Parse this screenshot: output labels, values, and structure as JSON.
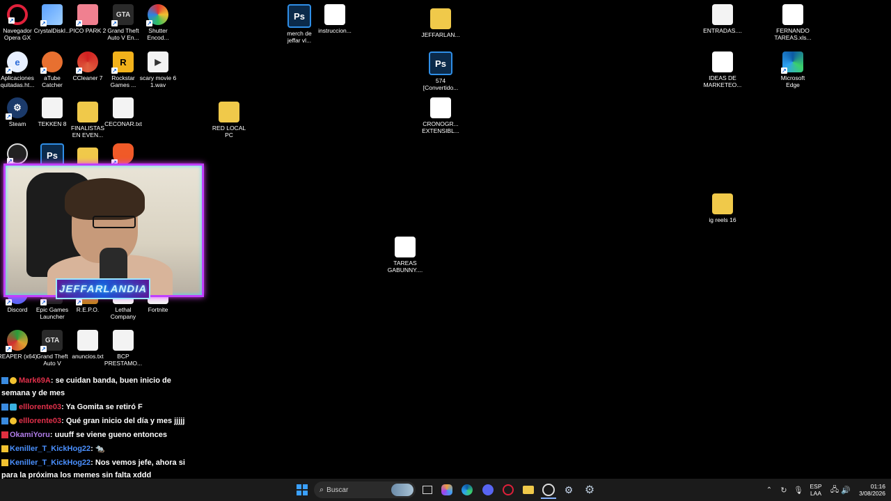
{
  "desktop_icons": {
    "opera": "Navegador\nOpera GX",
    "crystaldisk": "CrystalDiskI...",
    "picopark": "PICO PARK 2",
    "gta_en": "Grand Theft\nAuto V En...",
    "shutter_encod": "Shutter\nEncod...",
    "merch": "merch de\njeffar vl...",
    "instruccion": "instruccion...",
    "jeffarlan_folder": "JEFFARLAN...",
    "entradas": "ENTRADAS....",
    "fernando": "FERNANDO\nTAREAS.xls...",
    "aplicaciones": "Aplicaciones\nquitadas.ht...",
    "atube": "aTube\nCatcher",
    "ccleaner": "CCleaner 7",
    "rockstar": "Rockstar\nGames ...",
    "scary": "scary movie 6\n1.wav",
    "ps574": "574\n[Convertido...",
    "ideas": "IDEAS DE\nMARKETEO...",
    "edge": "Microsoft\nEdge",
    "steam": "Steam",
    "tekken": "TEKKEN 8",
    "finalistas": "FINALISTAS\nEN EVEN...",
    "ceconar": "CECONAR.txt",
    "redlocal": "RED LOCAL\nPC",
    "cronogr": "CRONOGR...\nEXTENSIBL...",
    "igreels": "ig reels 16",
    "tareas_gab": "TAREAS\nGABUNNY....",
    "discord": "Discord",
    "epic": "Epic Games\nLauncher",
    "repo": "R.E.P.O.",
    "lethal": "Lethal\nCompany",
    "fortnite": "Fortnite",
    "reaper": "REAPER (x64)",
    "gta_v": "Grand Theft\nAuto V",
    "anuncios": "anuncios.txt",
    "bcp": "BCP\nPRESTAMO..."
  },
  "webcam": {
    "banner_text": "JEFFARLANDIA"
  },
  "chat": [
    {
      "user": "Mark69A",
      "user_color": "#e0304a",
      "text": ": se cuidan banda, buen inicio de semana y de mes"
    },
    {
      "user": "elllorente03",
      "user_color": "#e0304a",
      "text": ": Ya Gomita se retiró F"
    },
    {
      "user": "elllorente03",
      "user_color": "#e0304a",
      "text": ": Qué gran inicio del día y mes jjjjj"
    },
    {
      "user": "OkamiYoru",
      "user_color": "#b07ce8",
      "text": ": uuuff se viene gueno entonces"
    },
    {
      "user": "Keniller_T_KickHog22",
      "user_color": "#4a90ff",
      "text": ": 🐀"
    },
    {
      "user": "Keniller_T_KickHog22",
      "user_color": "#4a90ff",
      "text": ": Nos vemos jefe, ahora si para la próxima los memes sin falta xddd"
    }
  ],
  "taskbar": {
    "search_placeholder": "Buscar",
    "lang_top": "ESP",
    "lang_bottom": "LAA",
    "time": "01:16",
    "date": "3/08/2026"
  }
}
